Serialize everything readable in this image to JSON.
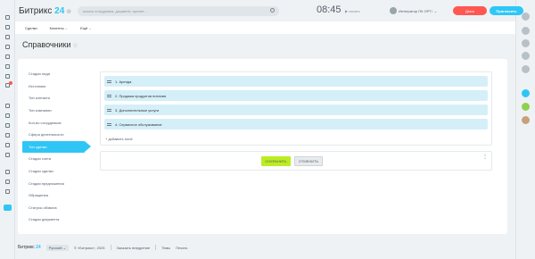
{
  "header": {
    "logo_text": "Битрикс",
    "logo_num": "24",
    "search_placeholder": "искать сотрудника, документ, прочее...",
    "clock": "08:45",
    "clock_status": "начать",
    "user_name": "Интегратор ПК ОРТ!",
    "demo_label": "Демо",
    "invite_label": "Пригласить"
  },
  "crm_nav": {
    "items": [
      "Сделки",
      "Клиенты",
      "Ещё"
    ]
  },
  "page": {
    "title": "Справочники"
  },
  "menu": {
    "items": [
      "Стадии лида",
      "Источники",
      "Тип контакта",
      "Тип компании",
      "Кол-во сотрудников",
      "Сфера деятельности",
      "Тип сделки",
      "Стадии счета",
      "Стадии сделки",
      "Стадии предложения",
      "Обращения",
      "Статусы обзвона",
      "Стадии документа"
    ],
    "active_index": 6
  },
  "list": {
    "rows": [
      "1. Аренда",
      "2. Продажа продуктов питания",
      "3. Дополнительные услуги",
      "4. Сервисное обслуживание"
    ],
    "add_field": "+ добавить поле"
  },
  "actions": {
    "save": "СОХРАНИТЬ",
    "cancel": "ОТМЕНИТЬ"
  },
  "footer": {
    "logo_text": "Битрикс",
    "logo_num": "24",
    "language": "Русский",
    "copyright": "© «Битрикс», 2025",
    "order_link": "Заказать внедрение",
    "themes": "Темы",
    "print": "Печать"
  },
  "colors": {
    "accent": "#2fc6f6",
    "save": "#bbed21",
    "demo": "#ff5752",
    "row_bg": "#d5eff9"
  }
}
